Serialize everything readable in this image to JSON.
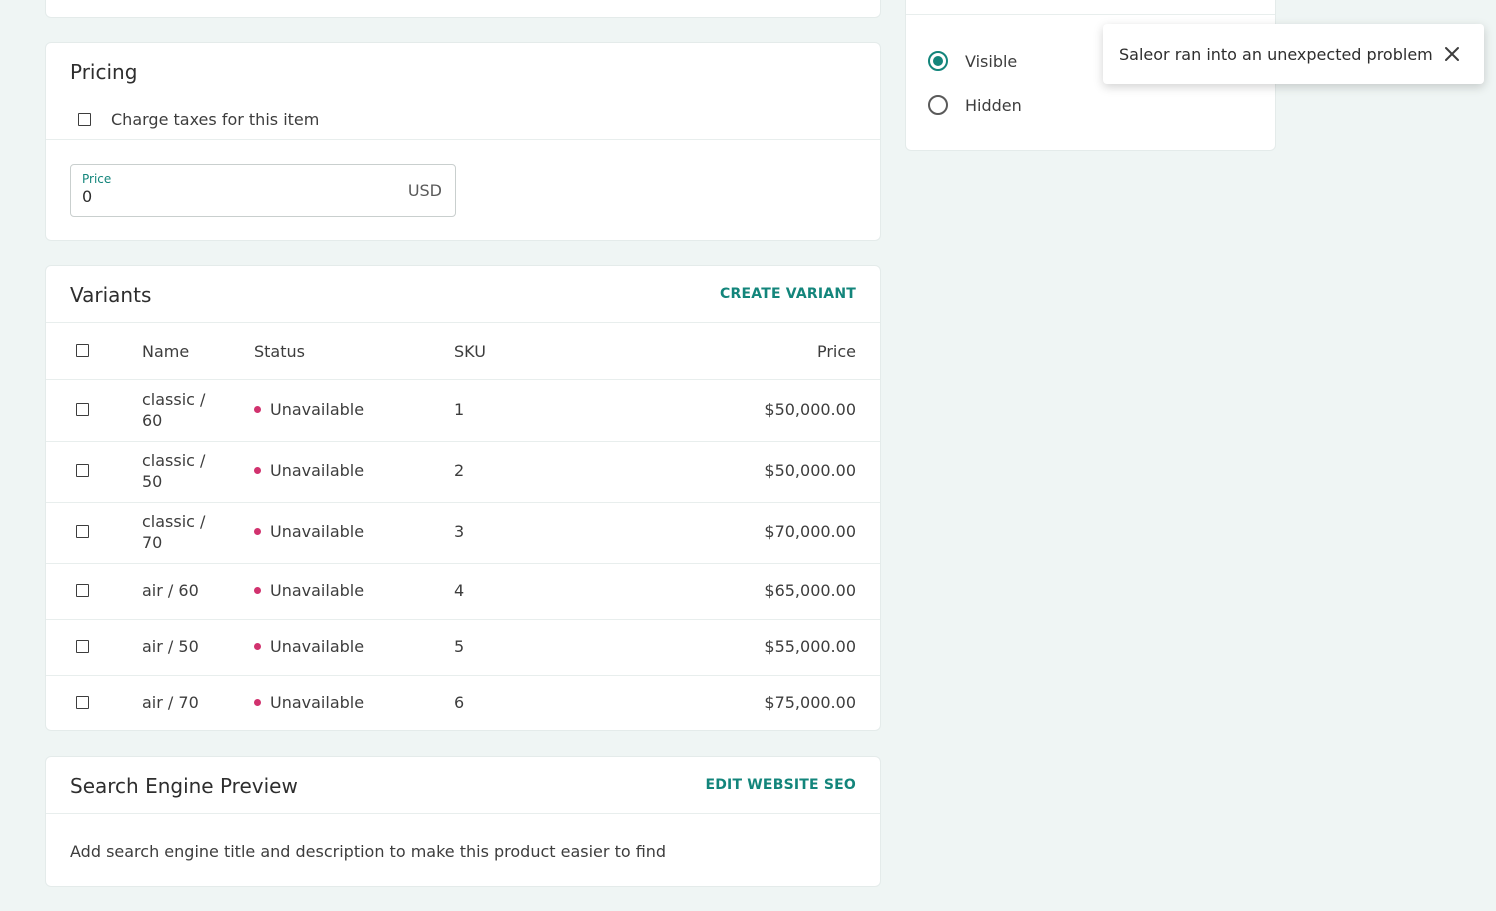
{
  "pricing": {
    "title": "Pricing",
    "charge_taxes_label": "Charge taxes for this item",
    "charge_taxes_checked": false,
    "price_label": "Price",
    "price_value": "0",
    "currency": "USD"
  },
  "variants": {
    "title": "Variants",
    "create_label": "CREATE VARIANT",
    "columns": {
      "name": "Name",
      "status": "Status",
      "sku": "SKU",
      "price": "Price"
    },
    "rows": [
      {
        "name1": "classic /",
        "name2": "60",
        "status": "Unavailable",
        "sku": "1",
        "price": "$50,000.00"
      },
      {
        "name1": "classic /",
        "name2": "50",
        "status": "Unavailable",
        "sku": "2",
        "price": "$50,000.00"
      },
      {
        "name1": "classic /",
        "name2": "70",
        "status": "Unavailable",
        "sku": "3",
        "price": "$70,000.00"
      },
      {
        "name1": "air / 60",
        "name2": "",
        "status": "Unavailable",
        "sku": "4",
        "price": "$65,000.00"
      },
      {
        "name1": "air / 50",
        "name2": "",
        "status": "Unavailable",
        "sku": "5",
        "price": "$55,000.00"
      },
      {
        "name1": "air / 70",
        "name2": "",
        "status": "Unavailable",
        "sku": "6",
        "price": "$75,000.00"
      }
    ]
  },
  "seo": {
    "title": "Search Engine Preview",
    "edit_label": "EDIT WEBSITE SEO",
    "description": "Add search engine title and description to make this product easier to find"
  },
  "visibility": {
    "visible_label": "Visible",
    "hidden_label": "Hidden",
    "selected": "Visible"
  },
  "toast": {
    "message": "Saleor ran into an unexpected problem"
  },
  "colors": {
    "accent": "#13857b",
    "unavailable": "#d1326e",
    "background": "#eff5f4"
  }
}
